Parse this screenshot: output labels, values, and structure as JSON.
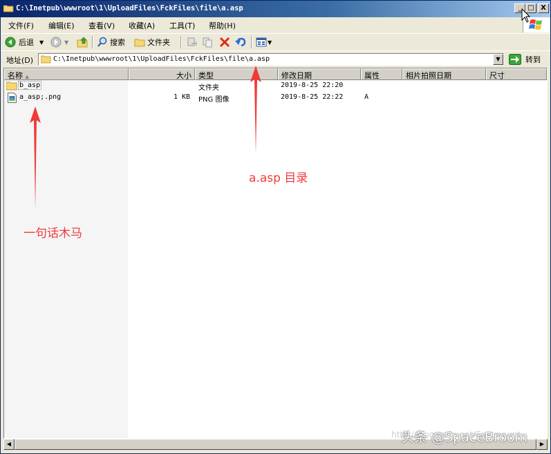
{
  "window": {
    "title": "C:\\Inetpub\\wwwroot\\1\\UploadFiles\\FckFiles\\file\\a.asp",
    "controls": [
      "_",
      "□",
      "X"
    ]
  },
  "menu": [
    "文件(F)",
    "编辑(E)",
    "查看(V)",
    "收藏(A)",
    "工具(T)",
    "帮助(H)"
  ],
  "toolbar": {
    "back_label": "后退",
    "search_label": "搜索",
    "folders_label": "文件夹",
    "icons": [
      "back-icon",
      "forward-icon",
      "up-folder-icon",
      "search-icon",
      "folders-icon",
      "move-to-icon",
      "copy-to-icon",
      "delete-icon",
      "undo-icon",
      "views-icon"
    ]
  },
  "address": {
    "label": "地址(D)",
    "value": "C:\\Inetpub\\wwwroot\\1\\UploadFiles\\FckFiles\\file\\a.asp",
    "go_label": "转到"
  },
  "columns": [
    "名称",
    "大小",
    "类型",
    "修改日期",
    "属性",
    "相片拍照日期",
    "尺寸"
  ],
  "files": [
    {
      "name": "b_asp",
      "size": "",
      "type": "文件夹",
      "modified": "2019-8-25 22:20",
      "attr": "",
      "icon": "folder-icon"
    },
    {
      "name": "a_asp;.png",
      "size": "1 KB",
      "type": "PNG 图像",
      "modified": "2019-8-25 22:22",
      "attr": "A",
      "icon": "png-file-icon"
    }
  ],
  "annotations": {
    "dir_label": "a.asp 目录",
    "trojan_label": "一句话木马",
    "color": "#f03a3a"
  },
  "watermark": {
    "main": "头条 @SpaceBroom",
    "faint": "http://blog.csdn.net/Eastmount"
  }
}
